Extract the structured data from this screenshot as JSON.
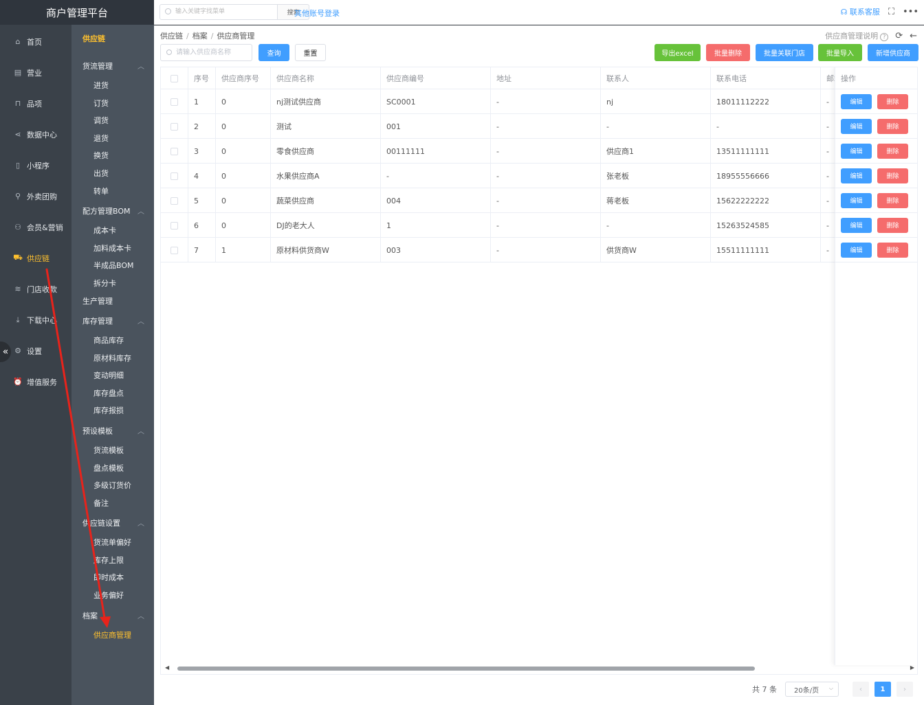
{
  "brand": "商户管理平台",
  "colors": {
    "accent": "#409eff",
    "active_menu": "#ffc12e",
    "success": "#67c23a",
    "danger": "#f56c6c",
    "annotation": "#e8231b"
  },
  "primary_nav": [
    {
      "label": "首页",
      "icon": "home-icon"
    },
    {
      "label": "营业",
      "icon": "calendar-icon"
    },
    {
      "label": "品项",
      "icon": "bag-icon"
    },
    {
      "label": "数据中心",
      "icon": "share-icon"
    },
    {
      "label": "小程序",
      "icon": "phone-icon"
    },
    {
      "label": "外卖团购",
      "icon": "bike-icon"
    },
    {
      "label": "会员&营销",
      "icon": "user-icon"
    },
    {
      "label": "供应链",
      "icon": "truck-icon",
      "active": true
    },
    {
      "label": "门店收款",
      "icon": "coins-icon"
    },
    {
      "label": "下载中心",
      "icon": "download-icon"
    },
    {
      "label": "设置",
      "icon": "gear-icon"
    },
    {
      "label": "增值服务",
      "icon": "alarm-icon"
    }
  ],
  "secondary_nav": {
    "title": "供应链",
    "groups": [
      {
        "label": "货流管理",
        "items": [
          "进货",
          "订货",
          "调货",
          "退货",
          "换货",
          "出货",
          "转单"
        ]
      },
      {
        "label": "配方管理BOM",
        "items": [
          "成本卡",
          "加料成本卡",
          "半成品BOM",
          "拆分卡"
        ]
      },
      {
        "label": "生产管理",
        "items": []
      },
      {
        "label": "库存管理",
        "items": [
          "商品库存",
          "原材料库存",
          "变动明细",
          "库存盘点",
          "库存报损"
        ]
      },
      {
        "label": "预设模板",
        "items": [
          "货流模板",
          "盘点模板",
          "多级订货价",
          "备注"
        ]
      },
      {
        "label": "供应链设置",
        "items": [
          "货流单偏好",
          "库存上限",
          "即时成本",
          "业务偏好"
        ]
      },
      {
        "label": "档案",
        "items": [
          "供应商管理"
        ]
      }
    ],
    "active_item": "供应商管理"
  },
  "topbar": {
    "search_placeholder": "输入关键字找菜单",
    "search_button": "搜索",
    "other_login": "其他账号登录",
    "contact_service": "联系客服"
  },
  "breadcrumb": [
    "供应链",
    "档案",
    "供应商管理"
  ],
  "help_text": "供应商管理说明",
  "toolbar": {
    "name_placeholder": "请输入供应商名称",
    "query": "查询",
    "reset": "重置",
    "export": "导出excel",
    "batch_delete": "批量删除",
    "batch_link_store": "批量关联门店",
    "batch_import": "批量导入",
    "add_supplier": "新增供应商"
  },
  "table": {
    "columns": [
      "",
      "序号",
      "供应商序号",
      "供应商名称",
      "供应商编号",
      "地址",
      "联系人",
      "联系电话",
      "邮箱"
    ],
    "op_column": "操作",
    "edit_label": "编辑",
    "delete_label": "删除",
    "rows": [
      [
        "1",
        "0",
        "nj测试供应商",
        "SC0001",
        "-",
        "nj",
        "18011112222",
        "-"
      ],
      [
        "2",
        "0",
        "测试",
        "001",
        "-",
        "-",
        "-",
        "-"
      ],
      [
        "3",
        "0",
        "零食供应商",
        "00111111",
        "-",
        "供应商1",
        "13511111111",
        "-"
      ],
      [
        "4",
        "0",
        "水果供应商A",
        "-",
        "-",
        "张老板",
        "18955556666",
        "-"
      ],
      [
        "5",
        "0",
        "蔬菜供应商",
        "004",
        "-",
        "蒋老板",
        "15622222222",
        "-"
      ],
      [
        "6",
        "0",
        "DJ的老大人",
        "1",
        "-",
        "-",
        "15263524585",
        "-"
      ],
      [
        "7",
        "1",
        "原材料供货商W",
        "003",
        "-",
        "供货商W",
        "15511111111",
        "-"
      ]
    ]
  },
  "pagination": {
    "total": "共 7 条",
    "page_size": "20条/页",
    "current": "1"
  }
}
